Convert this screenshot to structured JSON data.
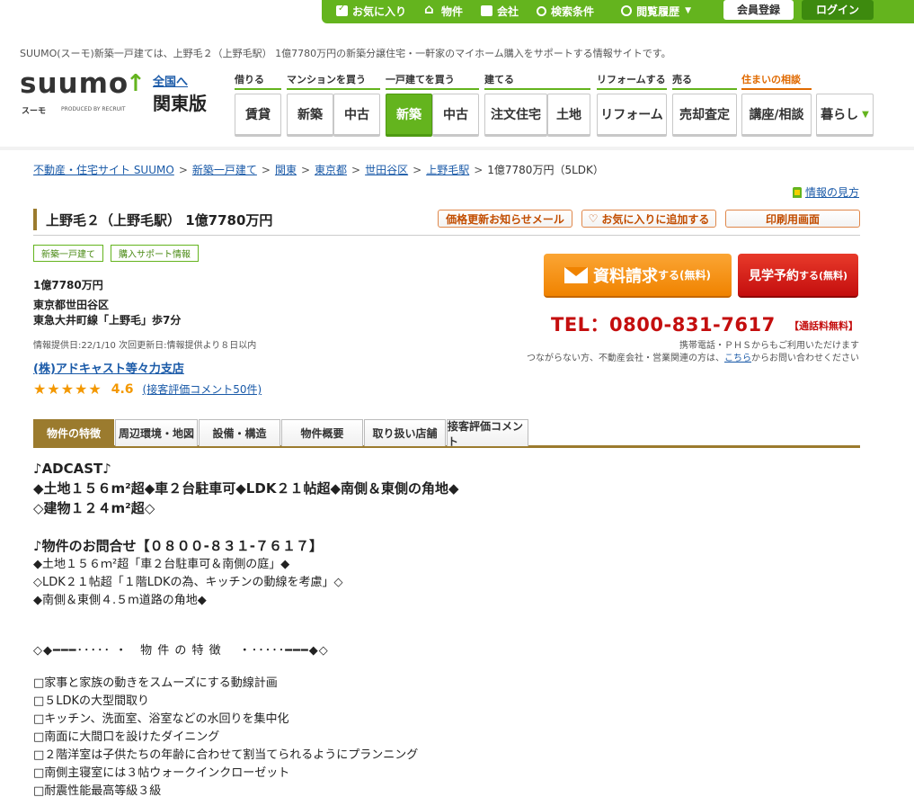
{
  "topbar": {
    "favorites": "お気に入り",
    "property": "物件",
    "company": "会社",
    "search_conditions": "検索条件",
    "history": "閲覧履歴",
    "member_register": "会員登録",
    "login": "ログイン"
  },
  "site_desc": "SUUMO(スーモ)新築一戸建ては、上野毛２（上野毛駅） 1億7780万円の新築分譲住宅・一軒家のマイホーム購入をサポートする情報サイトです。",
  "logo": {
    "word": "suumo",
    "kana": "スーモ",
    "recruit": "PRODUCED BY RECRUIT"
  },
  "region": {
    "all_link": "全国へ",
    "name": "関東版"
  },
  "nav": {
    "categories": [
      {
        "label": "借りる"
      },
      {
        "label": "マンションを買う"
      },
      {
        "label": "一戸建てを買う"
      },
      {
        "label": "建てる"
      },
      {
        "label": "リフォームする"
      },
      {
        "label": "売る"
      },
      {
        "label": "住まいの相談"
      }
    ],
    "buttons": [
      {
        "label": "賃貸"
      },
      {
        "label": "新築"
      },
      {
        "label": "中古"
      },
      {
        "label": "新築"
      },
      {
        "label": "中古"
      },
      {
        "label": "注文住宅"
      },
      {
        "label": "土地"
      },
      {
        "label": "リフォーム"
      },
      {
        "label": "売却査定"
      },
      {
        "label": "講座/相談"
      },
      {
        "label": "暮らし"
      }
    ]
  },
  "breadcrumb": [
    "不動産・住宅サイト SUUMO",
    "新築一戸建て",
    "関東",
    "東京都",
    "世田谷区",
    "上野毛駅",
    "1億7780万円（5LDK）"
  ],
  "howto": "情報の見方",
  "property": {
    "title": "上野毛２（上野毛駅） 1億7780万円",
    "tags": [
      "新築一戸建て",
      "購入サポート情報"
    ],
    "price": "1億7780万円",
    "address": "東京都世田谷区",
    "access": "東急大井町線「上野毛」歩7分",
    "info_date": "情報提供日:22/1/10 次回更新日:情報提供より８日以内",
    "agent": "(株)アドキャスト等々力支店",
    "stars": "★★★★★",
    "rating": "4.6",
    "rating_comments": "(接客評価コメント50件)"
  },
  "title_buttons": {
    "price_mail": "価格更新お知らせメール",
    "add_favorite": "お気に入りに追加する",
    "print": "印刷用画面"
  },
  "cta": {
    "doc_big": "資料請求",
    "doc_small": "する(無料)",
    "visit_big": "見学予約",
    "visit_small": "する(無料)",
    "tel": "TEL：0800-831-7617",
    "tel_free": "【通話料無料】",
    "note1": "携帯電話・ＰＨＳからもご利用いただけます",
    "note2_pre": "つながらない方、不動産会社・営業関連の方は、",
    "note2_link": "こちら",
    "note2_post": "からお問い合わせください"
  },
  "tabs": [
    {
      "label": "物件の特徴"
    },
    {
      "label": "周辺環境・地図"
    },
    {
      "label": "設備・構造"
    },
    {
      "label": "物件概要"
    },
    {
      "label": "取り扱い店舗"
    },
    {
      "label": "接客評価コメント"
    }
  ],
  "content": {
    "h1": "♪ADCAST♪",
    "h2": "◆土地１５６m²超◆車２台駐車可◆LDK２１帖超◆南側＆東側の角地◆",
    "h3": "◇建物１２４m²超◇",
    "h4": "♪物件のお問合せ【０８００-８３１-７６１７】",
    "p1": "◆土地１５６ｍ²超「車２台駐車可＆南側の庭」◆",
    "p2": "◇LDK２１帖超「１階LDKの為、キッチンの動線を考慮」◇",
    "p3": "◆南側＆東側４.５m道路の角地◆",
    "divider": "◇◆━━━･････ ・　物 件 の 特 徴　 ・･････━━━◆◇",
    "items": [
      "□家事と家族の動きをスムーズにする動線計画",
      "□５LDKの大型間取り",
      "□キッチン、洗面室、浴室などの水回りを集中化",
      "□南面に大間口を設けたダイニング",
      "□２階洋室は子供たちの年齢に合わせて割当てられるようにプランニング",
      "□南側主寝室には３帖ウォークインクローゼット",
      "□耐震性能最高等級３級"
    ]
  }
}
